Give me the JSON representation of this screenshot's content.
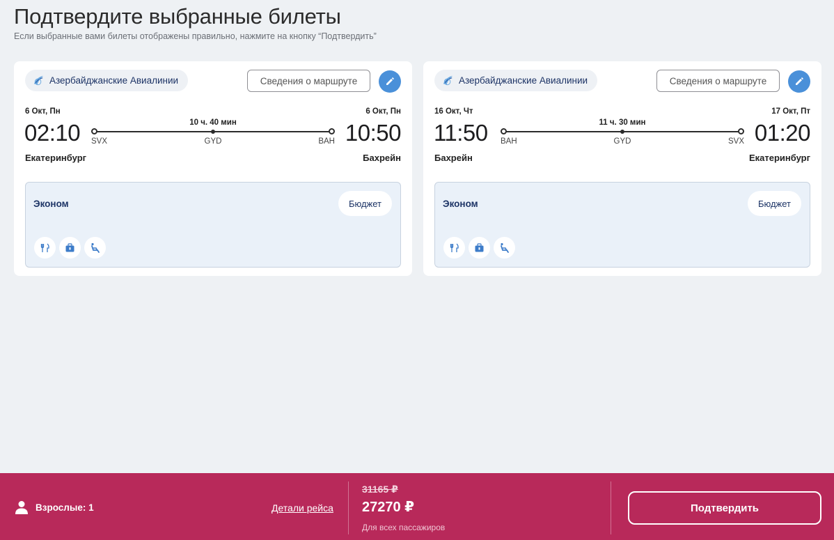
{
  "header": {
    "title": "Подтвердите выбранные билеты",
    "subtitle": "Если выбранные вами билеты отображены правильно, нажмите на кнопку “Подтвердить”"
  },
  "colors": {
    "brand_footer": "#b8295a",
    "accent_blue": "#4a90d9",
    "fare_box_bg": "#eaf1f9",
    "page_bg": "#eef1f4"
  },
  "flights": [
    {
      "airline": "Азербайджанские Авиалинии",
      "route_details_label": "Сведения о маршруте",
      "departure": {
        "date": "6 Окт, Пн",
        "time": "02:10",
        "city": "Екатеринбург",
        "code": "SVX"
      },
      "arrival": {
        "date": "6 Окт, Пн",
        "time": "10:50",
        "city": "Бахрейн",
        "code": "BAH"
      },
      "duration": "10 ч. 40 мин",
      "stop_code": "GYD",
      "fare": {
        "class": "Эконом",
        "tariff": "Бюджет",
        "amenities": [
          "meal-icon",
          "baggage-icon",
          "seat-icon"
        ]
      }
    },
    {
      "airline": "Азербайджанские Авиалинии",
      "route_details_label": "Сведения о маршруте",
      "departure": {
        "date": "16 Окт, Чт",
        "time": "11:50",
        "city": "Бахрейн",
        "code": "BAH"
      },
      "arrival": {
        "date": "17 Окт, Пт",
        "time": "01:20",
        "city": "Екатеринбург",
        "code": "SVX"
      },
      "duration": "11 ч. 30 мин",
      "stop_code": "GYD",
      "fare": {
        "class": "Эконом",
        "tariff": "Бюджет",
        "amenities": [
          "meal-icon",
          "baggage-icon",
          "seat-icon"
        ]
      }
    }
  ],
  "footer": {
    "passengers": "Взрослые: 1",
    "details_link": "Детали рейса",
    "old_price": "31165 ₽",
    "new_price": "27270 ₽",
    "price_note": "Для всех пассажиров",
    "confirm_label": "Подтвердить"
  }
}
